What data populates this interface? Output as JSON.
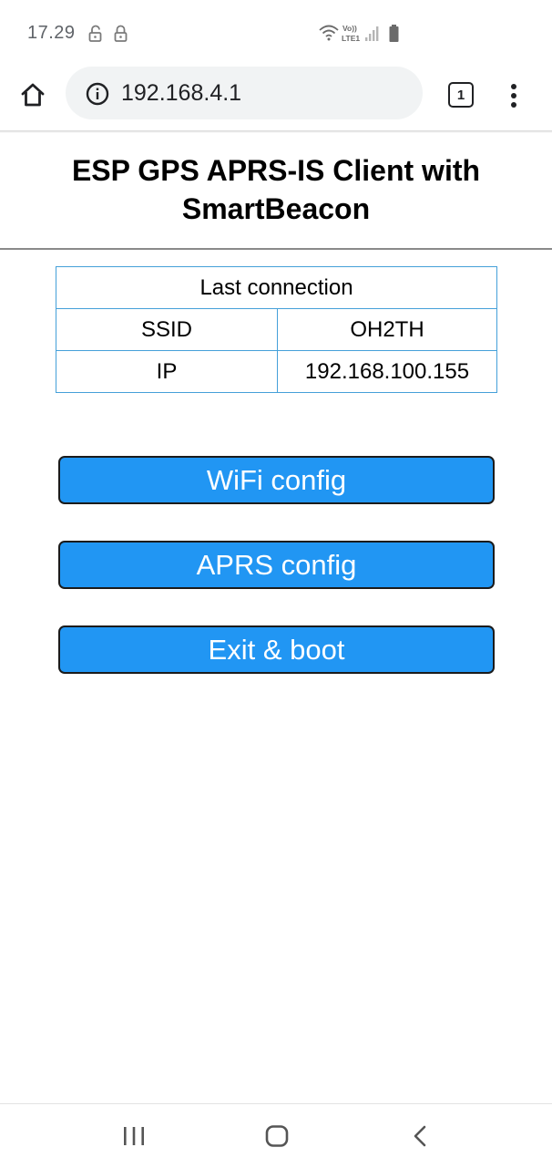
{
  "status_bar": {
    "time": "17.29",
    "icons": [
      "unlock-icon",
      "lock-icon",
      "wifi-icon",
      "volte-lte1-icon",
      "signal-icon",
      "battery-icon"
    ]
  },
  "browser": {
    "url": "192.168.4.1",
    "tab_count": "1",
    "icons": [
      "home-icon",
      "info-icon",
      "tabs-icon",
      "more-vert-icon"
    ]
  },
  "page": {
    "title": "ESP GPS APRS-IS Client with SmartBeacon",
    "last_connection": {
      "header": "Last connection",
      "rows": [
        {
          "label": "SSID",
          "value": "OH2TH"
        },
        {
          "label": "IP",
          "value": "192.168.100.155"
        }
      ]
    },
    "buttons": {
      "wifi_config": "WiFi config",
      "aprs_config": "APRS config",
      "exit_boot": "Exit & boot"
    },
    "accent_color": "#2196f3",
    "table_border_color": "#45a0d9"
  },
  "nav_bar": {
    "icons": [
      "recents-icon",
      "home-nav-icon",
      "back-icon"
    ]
  }
}
